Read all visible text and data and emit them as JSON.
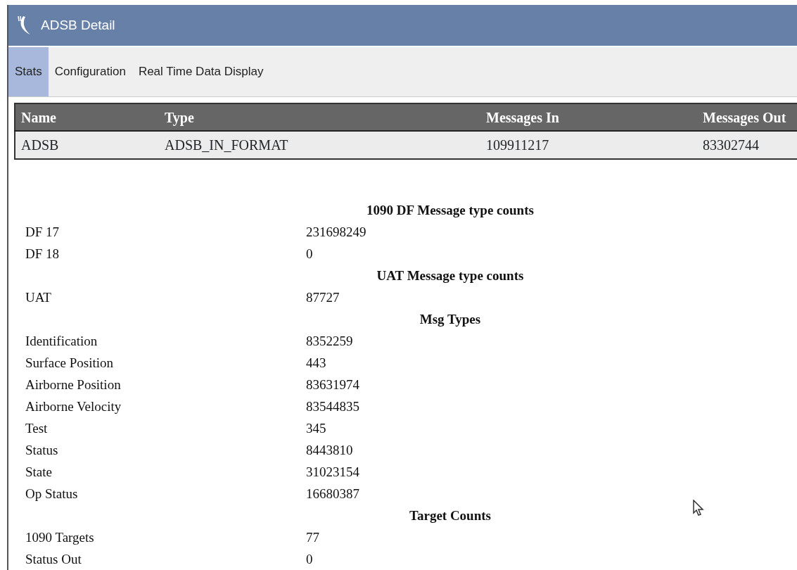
{
  "window": {
    "title": "ADSB Detail"
  },
  "tabs": [
    {
      "label": "Stats",
      "selected": true
    },
    {
      "label": "Configuration",
      "selected": false
    },
    {
      "label": "Real Time Data Display",
      "selected": false
    }
  ],
  "table": {
    "columns": [
      "Name",
      "Type",
      "Messages In",
      "Messages Out"
    ],
    "rows": [
      [
        "ADSB",
        "ADSB_IN_FORMAT",
        "109911217",
        "83302744"
      ]
    ]
  },
  "sections": [
    {
      "heading": "1090 DF Message type counts",
      "rows": [
        {
          "label": "DF 17",
          "value": "231698249"
        },
        {
          "label": "DF 18",
          "value": "0"
        }
      ]
    },
    {
      "heading": "UAT Message type counts",
      "rows": [
        {
          "label": "UAT",
          "value": "87727"
        }
      ]
    },
    {
      "heading": "Msg Types",
      "rows": [
        {
          "label": "Identification",
          "value": "8352259"
        },
        {
          "label": "Surface Position",
          "value": "443"
        },
        {
          "label": "Airborne Position",
          "value": "83631974"
        },
        {
          "label": "Airborne Velocity",
          "value": "83544835"
        },
        {
          "label": "Test",
          "value": "345"
        },
        {
          "label": "Status",
          "value": "8443810"
        },
        {
          "label": "State",
          "value": "31023154"
        },
        {
          "label": "Op Status",
          "value": "16680387"
        }
      ]
    },
    {
      "heading": "Target Counts",
      "rows": [
        {
          "label": "1090 Targets",
          "value": "77"
        },
        {
          "label": "Status Out",
          "value": "0"
        }
      ]
    }
  ]
}
